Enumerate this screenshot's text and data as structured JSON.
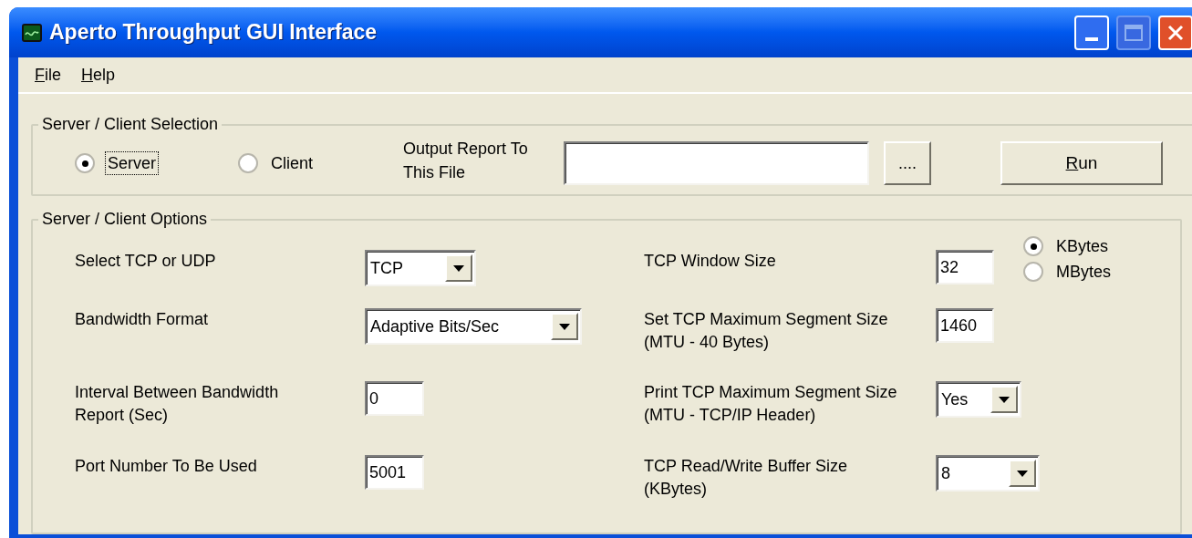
{
  "window": {
    "title": "Aperto Throughput GUI Interface"
  },
  "menu": [
    {
      "label": "File"
    },
    {
      "label": "Help"
    }
  ],
  "selection_group": {
    "title": "Server / Client Selection",
    "modes": [
      {
        "label": "Server",
        "selected": true
      },
      {
        "label": "Client",
        "selected": false
      }
    ],
    "output_label": "Output Report To This File",
    "browse_button": "....",
    "run_button": "Run"
  },
  "options_group": {
    "title": "Server / Client Options",
    "left": [
      {
        "kind": "dropdown",
        "label": "Select TCP or UDP",
        "value": "TCP"
      },
      {
        "kind": "dropdown",
        "label": "Bandwidth Format",
        "value": "Adaptive Bits/Sec"
      },
      {
        "kind": "field",
        "label": "Interval Between Bandwidth Report (Sec)",
        "value": "0"
      },
      {
        "kind": "field",
        "label": "Port Number To Be Used",
        "value": "5001"
      }
    ],
    "right": [
      {
        "kind": "field",
        "label": "TCP Window Size",
        "value": "32"
      },
      {
        "kind": "field",
        "label": "Set TCP Maximum Segment Size (MTU - 40 Bytes)",
        "value": "1460"
      },
      {
        "kind": "dropdown",
        "label": "Print TCP Maximum Segment Size (MTU - TCP/IP Header)",
        "value": "Yes"
      },
      {
        "kind": "dropdown",
        "label": "TCP Read/Write Buffer Size (KBytes)",
        "value": "8"
      }
    ],
    "units": [
      {
        "label": "KBytes",
        "selected": true
      },
      {
        "label": "MBytes",
        "selected": false
      }
    ]
  }
}
